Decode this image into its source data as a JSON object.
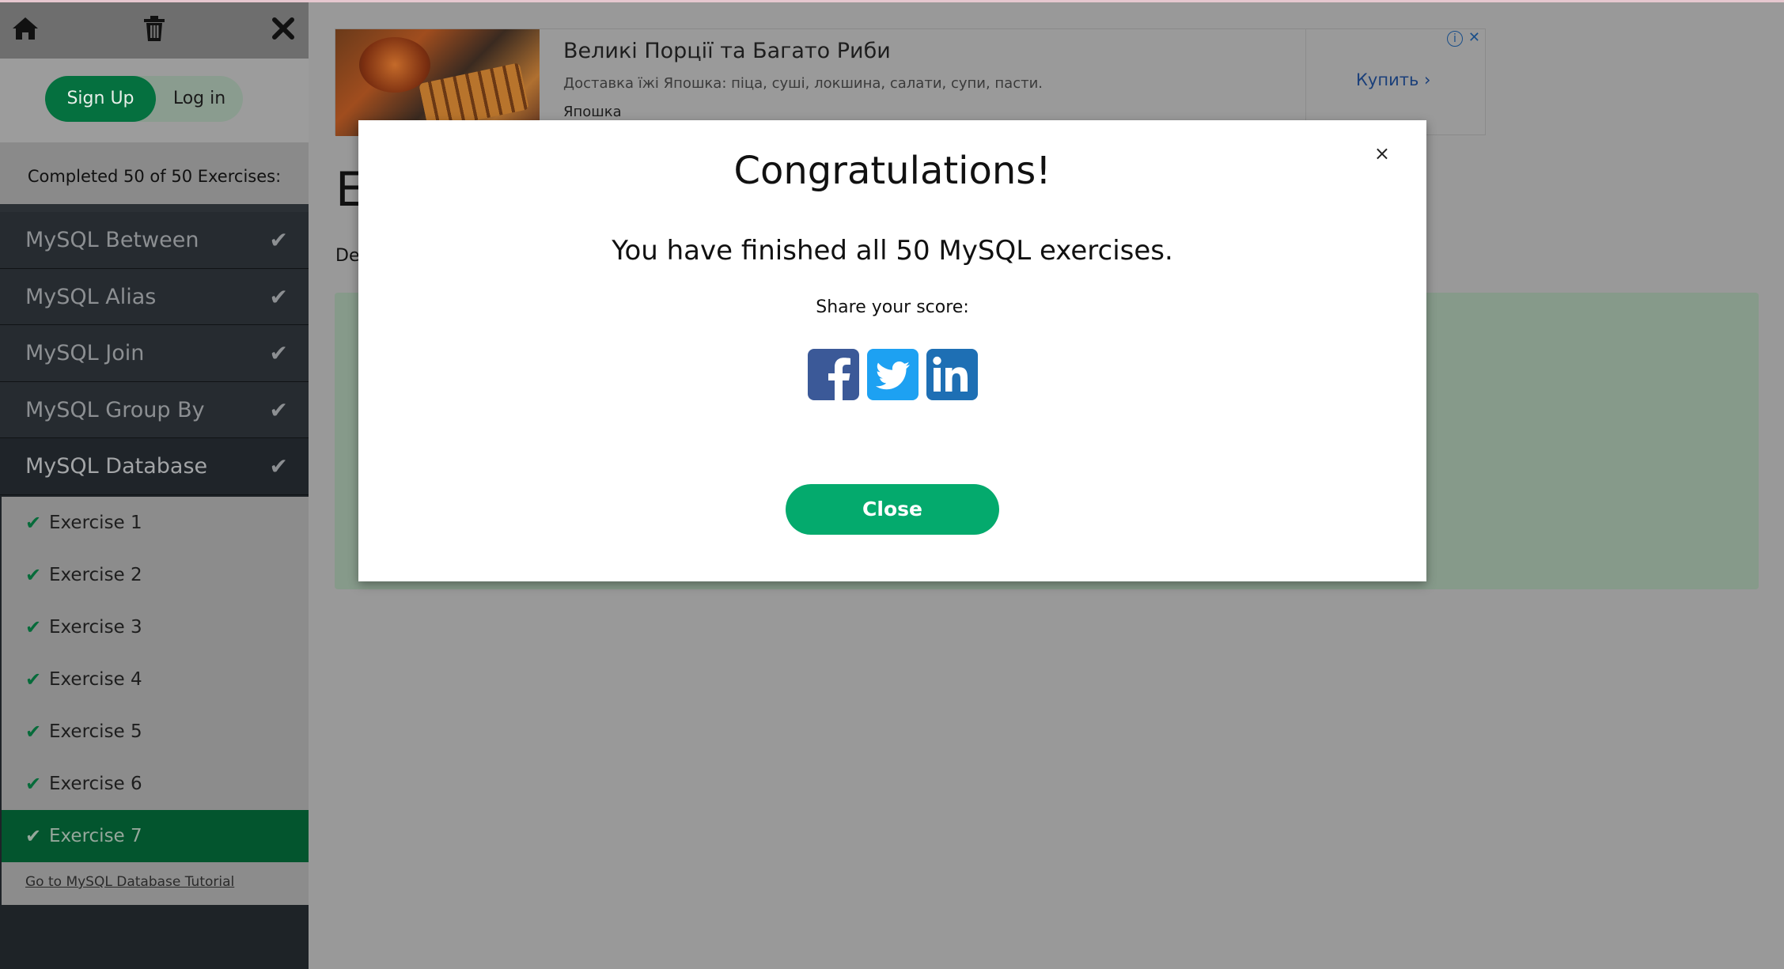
{
  "sidebar": {
    "home_icon": "home-icon",
    "trash_icon": "trash-icon",
    "close_icon": "close-icon",
    "signup_label": "Sign Up",
    "login_label": "Log in",
    "progress_text": "Completed 50 of 50 Exercises:",
    "progress_fraction": 1.0,
    "categories": [
      {
        "label": "MySQL Between"
      },
      {
        "label": "MySQL Alias"
      },
      {
        "label": "MySQL Join"
      },
      {
        "label": "MySQL Group By"
      },
      {
        "label": "MySQL Database"
      }
    ],
    "exercises": [
      {
        "label": "Exercise 1"
      },
      {
        "label": "Exercise 2"
      },
      {
        "label": "Exercise 3"
      },
      {
        "label": "Exercise 4"
      },
      {
        "label": "Exercise 5"
      },
      {
        "label": "Exercise 6"
      },
      {
        "label": "Exercise 7"
      }
    ],
    "tutorial_link": "Go to MySQL Database Tutorial"
  },
  "ad": {
    "title": "Великі Порції та Багато Риби",
    "description": "Доставка їжі Япошка: піца, суші, локшина, салати, супи, пасти.",
    "brand": "Япошка",
    "cta": "Купить",
    "info_icon": "info-icon",
    "close_icon": "close-icon"
  },
  "main": {
    "heading": "E",
    "desc": "De"
  },
  "modal": {
    "title": "Congratulations!",
    "message": "You have finished all 50 MySQL exercises.",
    "share_label": "Share your score:",
    "close_label": "Close",
    "x_label": "×"
  },
  "colors": {
    "accent": "#04aa6d",
    "facebook": "#3b5998",
    "twitter": "#1da1f2",
    "linkedin": "#1e6fb4"
  }
}
